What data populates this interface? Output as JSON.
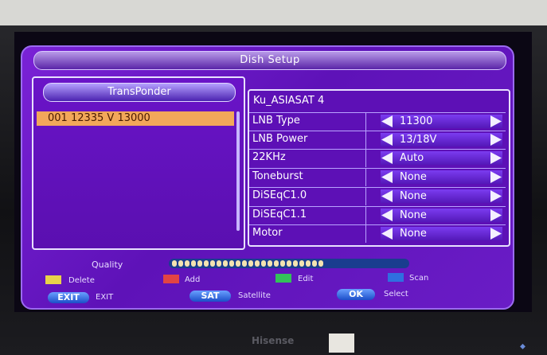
{
  "menu": {
    "title": "Dish Setup",
    "transponder_header": "TransPonder",
    "transponder_list": [
      "001 12335 V 13000"
    ],
    "satellite_name": "Ku_ASIASAT 4",
    "settings": [
      {
        "label": "LNB Type",
        "value": "11300"
      },
      {
        "label": "LNB Power",
        "value": "13/18V"
      },
      {
        "label": "22KHz",
        "value": "Auto"
      },
      {
        "label": "Toneburst",
        "value": "None"
      },
      {
        "label": "DiSEqC1.0",
        "value": "None"
      },
      {
        "label": "DiSEqC1.1",
        "value": "None"
      },
      {
        "label": "Motor",
        "value": "None"
      }
    ]
  },
  "quality": {
    "label": "Quality",
    "dots": 24
  },
  "color_keys": [
    {
      "color": "#e8d24a",
      "label": "Delete"
    },
    {
      "color": "#e24444",
      "label": "Add"
    },
    {
      "color": "#33c15a",
      "label": "Edit"
    },
    {
      "color": "#2f6fe0",
      "label": "Scan"
    }
  ],
  "buttons": [
    {
      "key": "EXIT",
      "label": "EXIT"
    },
    {
      "key": "SAT",
      "label": "Satellite"
    },
    {
      "key": "OK",
      "label": "Select"
    }
  ],
  "tv": {
    "brand": "Hisense"
  }
}
